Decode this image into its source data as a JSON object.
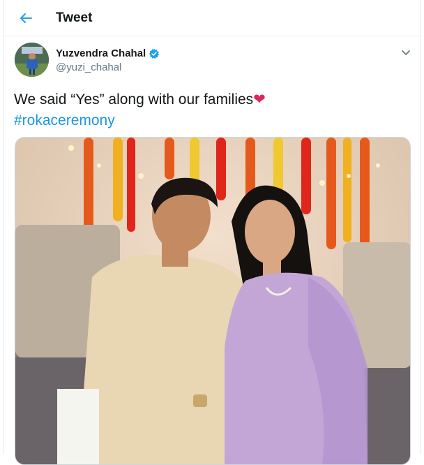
{
  "header": {
    "title": "Tweet",
    "back_icon": "back-arrow-icon"
  },
  "tweet": {
    "author_name": "Yuzvendra Chahal",
    "author_handle": "@yuzi_chahal",
    "verified_icon": "verified-badge-icon",
    "menu_icon": "chevron-down-icon",
    "text": "We said “Yes” along with our families",
    "emoji": "❤",
    "hashtag": "#rokaceremony"
  },
  "colors": {
    "accent": "#1da1f2",
    "link": "#1b95e0",
    "muted": "#657786",
    "heart": "#e0245e"
  }
}
